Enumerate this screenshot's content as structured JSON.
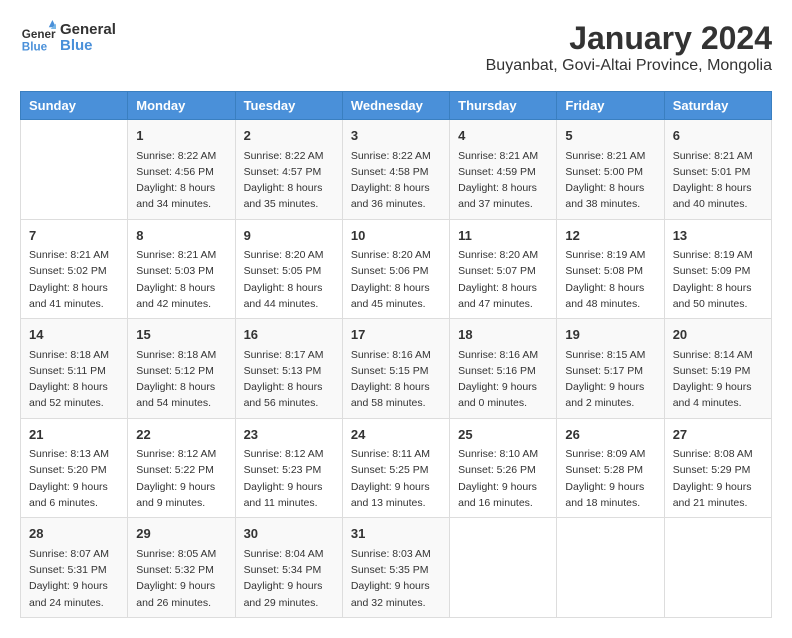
{
  "logo": {
    "line1": "General",
    "line2": "Blue"
  },
  "title": "January 2024",
  "subtitle": "Buyanbat, Govi-Altai Province, Mongolia",
  "headers": [
    "Sunday",
    "Monday",
    "Tuesday",
    "Wednesday",
    "Thursday",
    "Friday",
    "Saturday"
  ],
  "weeks": [
    [
      {
        "day": "",
        "info": ""
      },
      {
        "day": "1",
        "info": "Sunrise: 8:22 AM\nSunset: 4:56 PM\nDaylight: 8 hours\nand 34 minutes."
      },
      {
        "day": "2",
        "info": "Sunrise: 8:22 AM\nSunset: 4:57 PM\nDaylight: 8 hours\nand 35 minutes."
      },
      {
        "day": "3",
        "info": "Sunrise: 8:22 AM\nSunset: 4:58 PM\nDaylight: 8 hours\nand 36 minutes."
      },
      {
        "day": "4",
        "info": "Sunrise: 8:21 AM\nSunset: 4:59 PM\nDaylight: 8 hours\nand 37 minutes."
      },
      {
        "day": "5",
        "info": "Sunrise: 8:21 AM\nSunset: 5:00 PM\nDaylight: 8 hours\nand 38 minutes."
      },
      {
        "day": "6",
        "info": "Sunrise: 8:21 AM\nSunset: 5:01 PM\nDaylight: 8 hours\nand 40 minutes."
      }
    ],
    [
      {
        "day": "7",
        "info": "Sunrise: 8:21 AM\nSunset: 5:02 PM\nDaylight: 8 hours\nand 41 minutes."
      },
      {
        "day": "8",
        "info": "Sunrise: 8:21 AM\nSunset: 5:03 PM\nDaylight: 8 hours\nand 42 minutes."
      },
      {
        "day": "9",
        "info": "Sunrise: 8:20 AM\nSunset: 5:05 PM\nDaylight: 8 hours\nand 44 minutes."
      },
      {
        "day": "10",
        "info": "Sunrise: 8:20 AM\nSunset: 5:06 PM\nDaylight: 8 hours\nand 45 minutes."
      },
      {
        "day": "11",
        "info": "Sunrise: 8:20 AM\nSunset: 5:07 PM\nDaylight: 8 hours\nand 47 minutes."
      },
      {
        "day": "12",
        "info": "Sunrise: 8:19 AM\nSunset: 5:08 PM\nDaylight: 8 hours\nand 48 minutes."
      },
      {
        "day": "13",
        "info": "Sunrise: 8:19 AM\nSunset: 5:09 PM\nDaylight: 8 hours\nand 50 minutes."
      }
    ],
    [
      {
        "day": "14",
        "info": "Sunrise: 8:18 AM\nSunset: 5:11 PM\nDaylight: 8 hours\nand 52 minutes."
      },
      {
        "day": "15",
        "info": "Sunrise: 8:18 AM\nSunset: 5:12 PM\nDaylight: 8 hours\nand 54 minutes."
      },
      {
        "day": "16",
        "info": "Sunrise: 8:17 AM\nSunset: 5:13 PM\nDaylight: 8 hours\nand 56 minutes."
      },
      {
        "day": "17",
        "info": "Sunrise: 8:16 AM\nSunset: 5:15 PM\nDaylight: 8 hours\nand 58 minutes."
      },
      {
        "day": "18",
        "info": "Sunrise: 8:16 AM\nSunset: 5:16 PM\nDaylight: 9 hours\nand 0 minutes."
      },
      {
        "day": "19",
        "info": "Sunrise: 8:15 AM\nSunset: 5:17 PM\nDaylight: 9 hours\nand 2 minutes."
      },
      {
        "day": "20",
        "info": "Sunrise: 8:14 AM\nSunset: 5:19 PM\nDaylight: 9 hours\nand 4 minutes."
      }
    ],
    [
      {
        "day": "21",
        "info": "Sunrise: 8:13 AM\nSunset: 5:20 PM\nDaylight: 9 hours\nand 6 minutes."
      },
      {
        "day": "22",
        "info": "Sunrise: 8:12 AM\nSunset: 5:22 PM\nDaylight: 9 hours\nand 9 minutes."
      },
      {
        "day": "23",
        "info": "Sunrise: 8:12 AM\nSunset: 5:23 PM\nDaylight: 9 hours\nand 11 minutes."
      },
      {
        "day": "24",
        "info": "Sunrise: 8:11 AM\nSunset: 5:25 PM\nDaylight: 9 hours\nand 13 minutes."
      },
      {
        "day": "25",
        "info": "Sunrise: 8:10 AM\nSunset: 5:26 PM\nDaylight: 9 hours\nand 16 minutes."
      },
      {
        "day": "26",
        "info": "Sunrise: 8:09 AM\nSunset: 5:28 PM\nDaylight: 9 hours\nand 18 minutes."
      },
      {
        "day": "27",
        "info": "Sunrise: 8:08 AM\nSunset: 5:29 PM\nDaylight: 9 hours\nand 21 minutes."
      }
    ],
    [
      {
        "day": "28",
        "info": "Sunrise: 8:07 AM\nSunset: 5:31 PM\nDaylight: 9 hours\nand 24 minutes."
      },
      {
        "day": "29",
        "info": "Sunrise: 8:05 AM\nSunset: 5:32 PM\nDaylight: 9 hours\nand 26 minutes."
      },
      {
        "day": "30",
        "info": "Sunrise: 8:04 AM\nSunset: 5:34 PM\nDaylight: 9 hours\nand 29 minutes."
      },
      {
        "day": "31",
        "info": "Sunrise: 8:03 AM\nSunset: 5:35 PM\nDaylight: 9 hours\nand 32 minutes."
      },
      {
        "day": "",
        "info": ""
      },
      {
        "day": "",
        "info": ""
      },
      {
        "day": "",
        "info": ""
      }
    ]
  ]
}
